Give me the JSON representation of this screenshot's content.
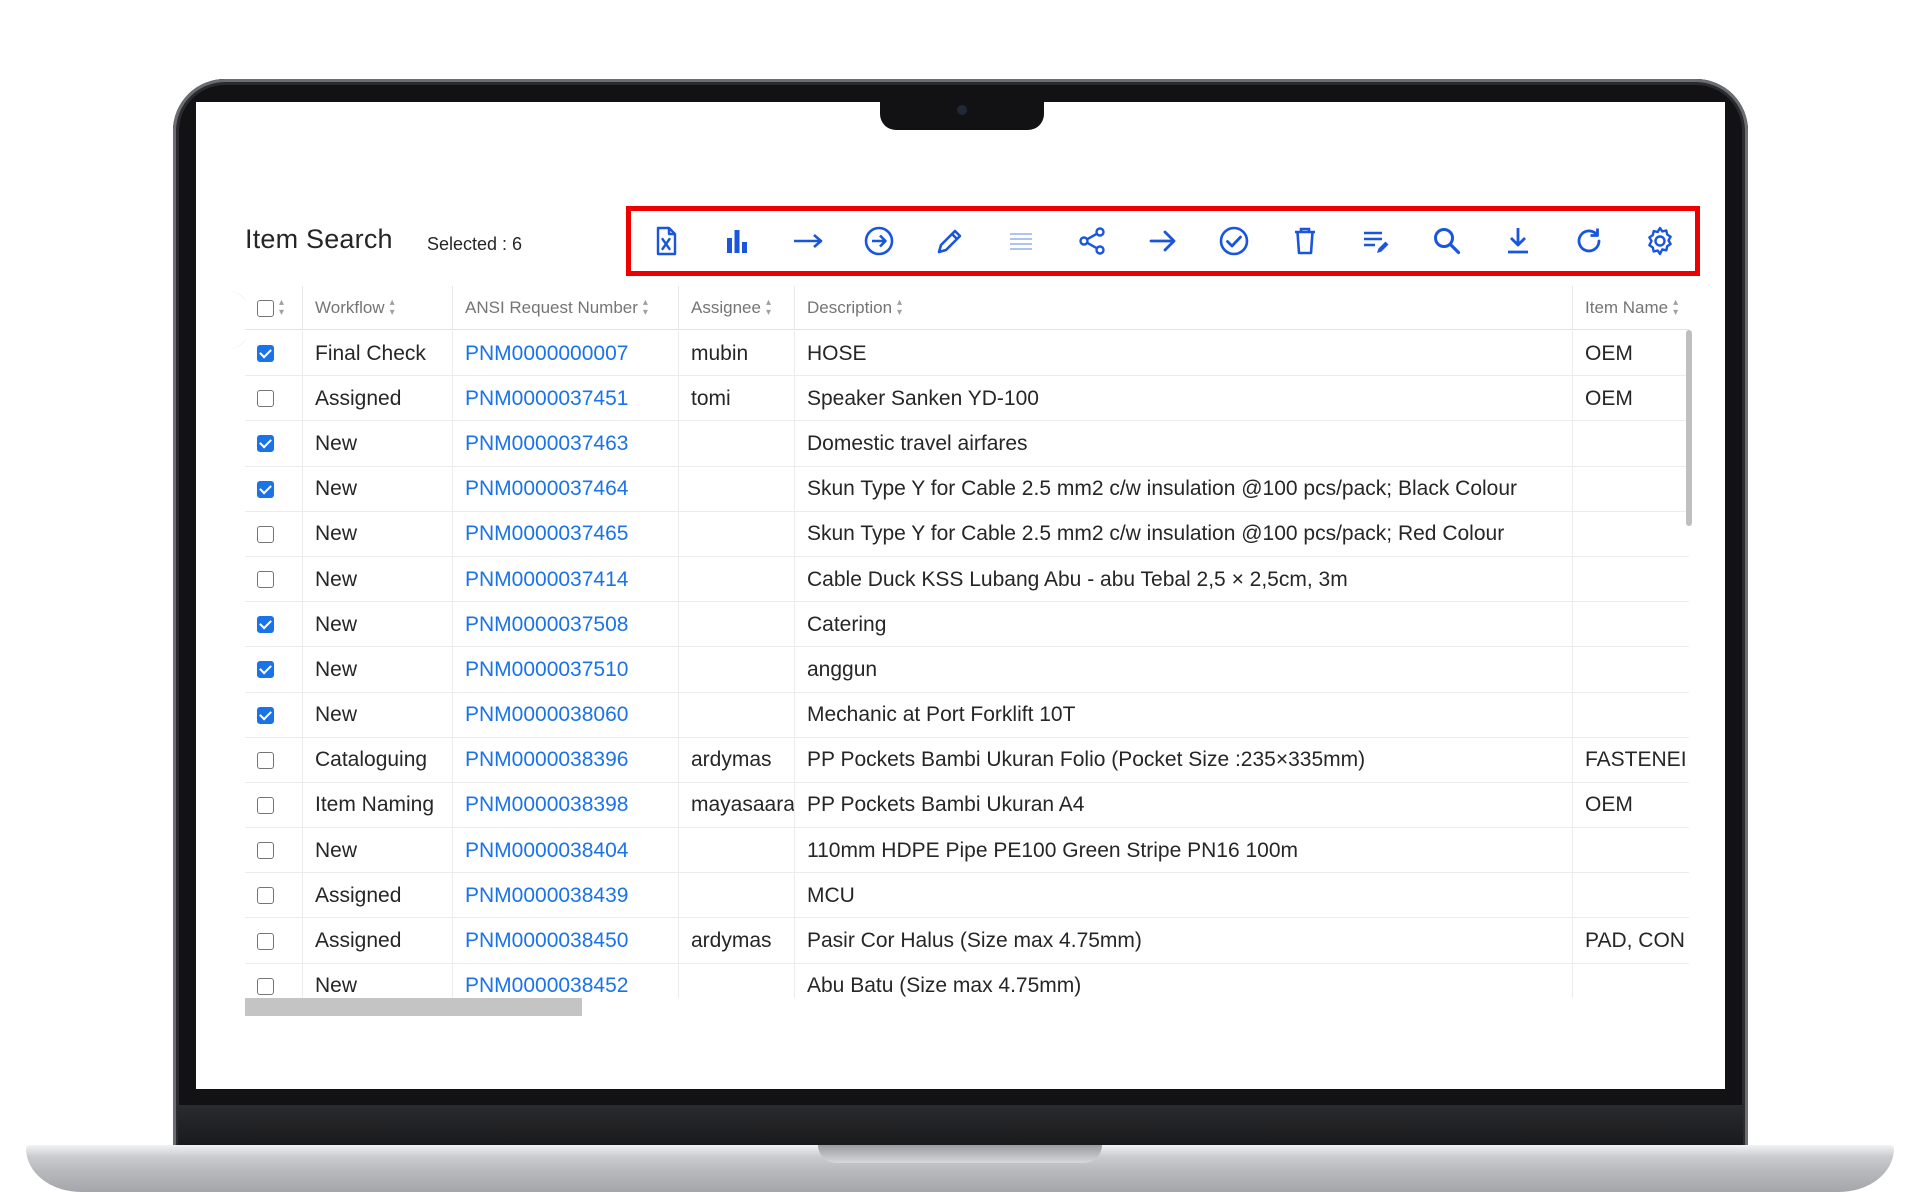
{
  "page": {
    "title": "Item Search",
    "selected_label": "Selected : 6"
  },
  "toolbar": {
    "highlight_color": "#ef0000",
    "icon_color": "#1a56db",
    "buttons": [
      {
        "icon": "excel-file-icon",
        "enabled": true
      },
      {
        "icon": "bar-chart-icon",
        "enabled": true
      },
      {
        "icon": "arrow-long-right-icon",
        "enabled": true
      },
      {
        "icon": "circle-arrow-right-icon",
        "enabled": true
      },
      {
        "icon": "pencil-icon",
        "enabled": true
      },
      {
        "icon": "list-icon",
        "enabled": false
      },
      {
        "icon": "share-icon",
        "enabled": true
      },
      {
        "icon": "arrow-right-icon",
        "enabled": true
      },
      {
        "icon": "check-circle-icon",
        "enabled": true
      },
      {
        "icon": "trash-icon",
        "enabled": true
      },
      {
        "icon": "edit-list-icon",
        "enabled": true
      },
      {
        "icon": "search-icon",
        "enabled": true
      },
      {
        "icon": "download-icon",
        "enabled": true
      },
      {
        "icon": "refresh-icon",
        "enabled": true
      },
      {
        "icon": "settings-icon",
        "enabled": true
      }
    ]
  },
  "grid": {
    "columns": [
      {
        "key": "check",
        "label": ""
      },
      {
        "key": "workflow",
        "label": "Workflow"
      },
      {
        "key": "ansi",
        "label": "ANSI Request Number"
      },
      {
        "key": "assignee",
        "label": "Assignee"
      },
      {
        "key": "description",
        "label": "Description"
      },
      {
        "key": "item_name",
        "label": "Item Name"
      }
    ],
    "rows": [
      {
        "checked": true,
        "workflow": "Final Check",
        "ansi": "PNM0000000007",
        "assignee": "mubin",
        "description": "HOSE",
        "item_name": "OEM"
      },
      {
        "checked": false,
        "workflow": "Assigned",
        "ansi": "PNM0000037451",
        "assignee": "tomi",
        "description": "Speaker Sanken YD-100",
        "item_name": "OEM"
      },
      {
        "checked": true,
        "workflow": "New",
        "ansi": "PNM0000037463",
        "assignee": "",
        "description": "Domestic travel airfares",
        "item_name": ""
      },
      {
        "checked": true,
        "workflow": "New",
        "ansi": "PNM0000037464",
        "assignee": "",
        "description": "Skun Type Y for Cable 2.5 mm2 c/w insulation @100 pcs/pack; Black Colour",
        "item_name": ""
      },
      {
        "checked": false,
        "workflow": "New",
        "ansi": "PNM0000037465",
        "assignee": "",
        "description": "Skun Type Y for Cable 2.5 mm2 c/w insulation @100 pcs/pack; Red Colour",
        "item_name": ""
      },
      {
        "checked": false,
        "workflow": "New",
        "ansi": "PNM0000037414",
        "assignee": "",
        "description": "Cable Duck KSS Lubang Abu - abu Tebal 2,5 × 2,5cm, 3m",
        "item_name": ""
      },
      {
        "checked": true,
        "workflow": "New",
        "ansi": "PNM0000037508",
        "assignee": "",
        "description": "Catering",
        "item_name": ""
      },
      {
        "checked": true,
        "workflow": "New",
        "ansi": "PNM0000037510",
        "assignee": "",
        "description": "anggun",
        "item_name": ""
      },
      {
        "checked": true,
        "workflow": "New",
        "ansi": "PNM0000038060",
        "assignee": "",
        "description": "Mechanic at Port Forklift 10T",
        "item_name": ""
      },
      {
        "checked": false,
        "workflow": "Cataloguing",
        "ansi": "PNM0000038396",
        "assignee": "ardymas",
        "description": "PP Pockets Bambi Ukuran Folio (Pocket Size :235×335mm)",
        "item_name": "FASTENEI"
      },
      {
        "checked": false,
        "workflow": "Item Naming",
        "ansi": "PNM0000038398",
        "assignee": "mayasaara",
        "description": "PP Pockets Bambi Ukuran A4",
        "item_name": "OEM"
      },
      {
        "checked": false,
        "workflow": "New",
        "ansi": "PNM0000038404",
        "assignee": "",
        "description": "110mm HDPE Pipe PE100 Green Stripe PN16 100m",
        "item_name": ""
      },
      {
        "checked": false,
        "workflow": "Assigned",
        "ansi": "PNM0000038439",
        "assignee": "",
        "description": "MCU",
        "item_name": ""
      },
      {
        "checked": false,
        "workflow": "Assigned",
        "ansi": "PNM0000038450",
        "assignee": "ardymas",
        "description": "Pasir Cor Halus (Size max 4.75mm)",
        "item_name": "PAD, CON"
      },
      {
        "checked": false,
        "workflow": "New",
        "ansi": "PNM0000038452",
        "assignee": "",
        "description": "Abu Batu (Size max 4.75mm)",
        "item_name": ""
      }
    ]
  }
}
